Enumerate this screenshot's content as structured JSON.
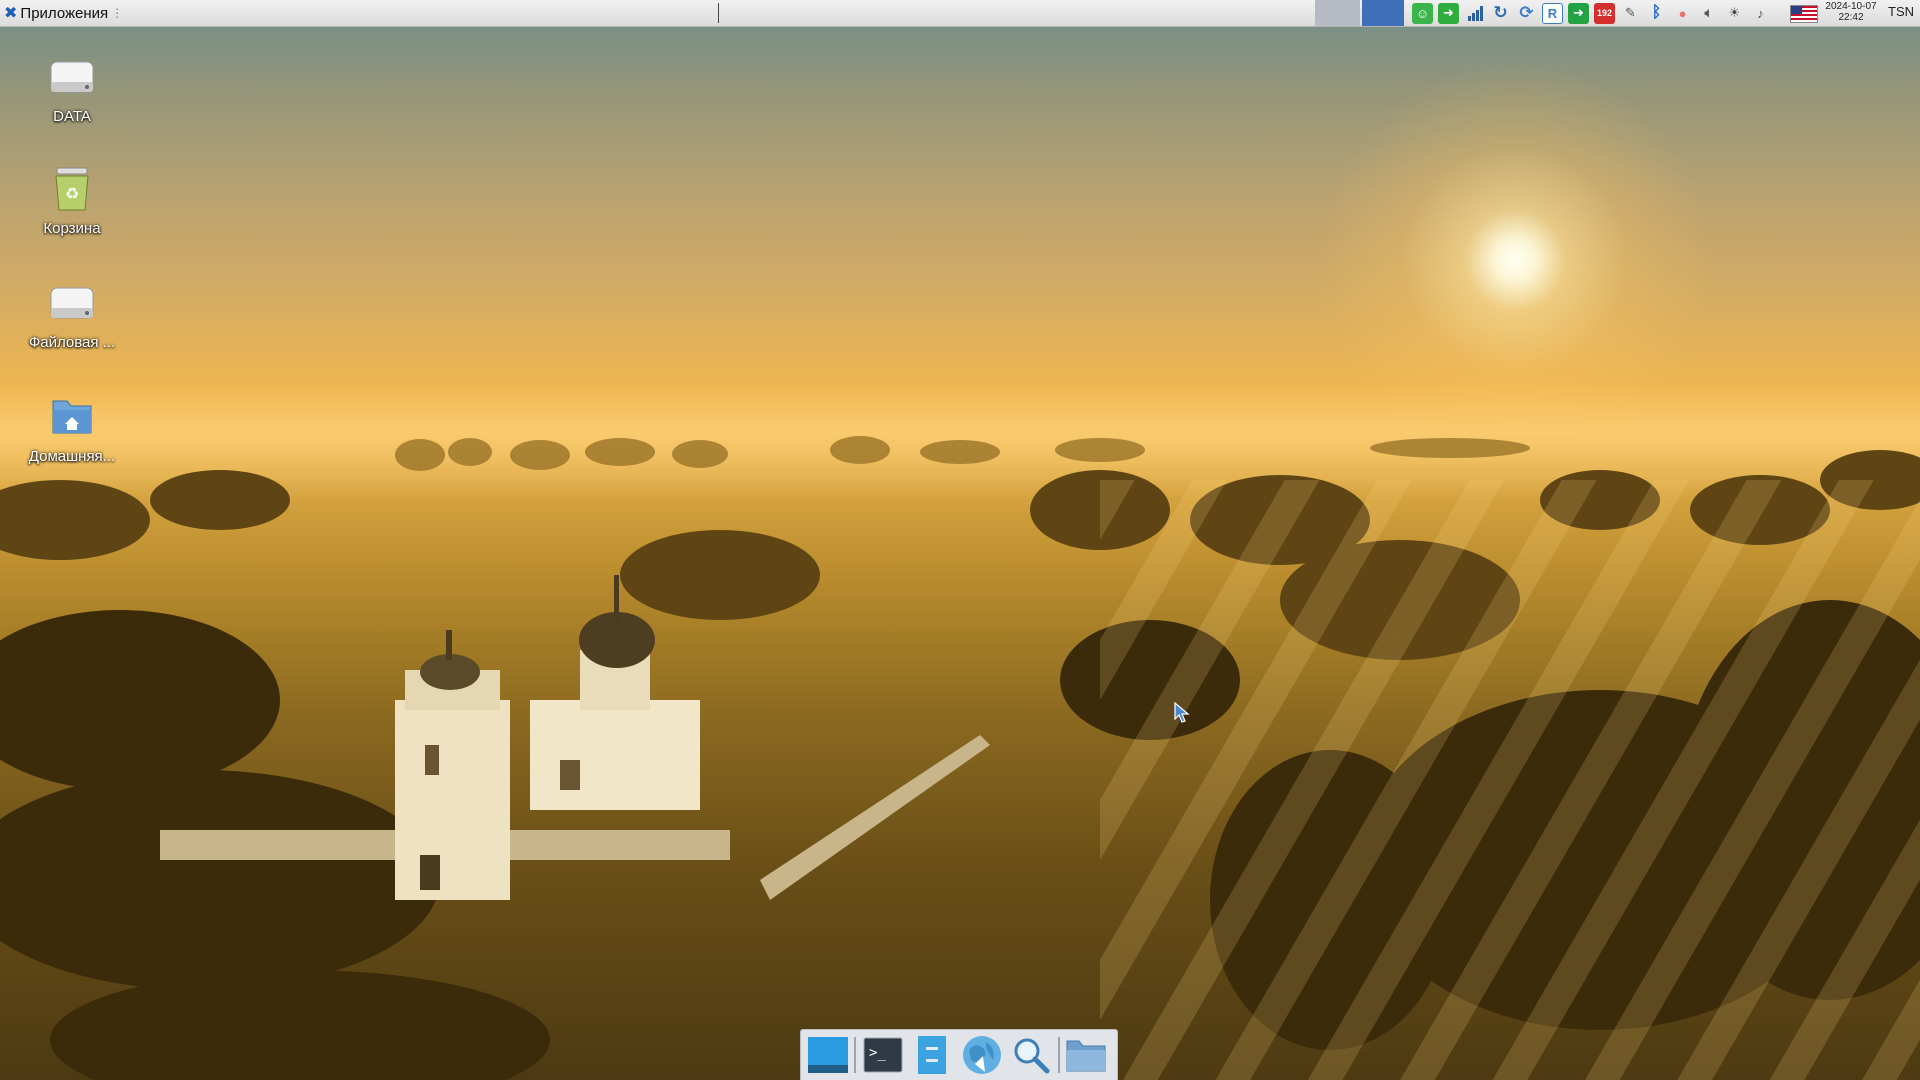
{
  "top_panel": {
    "apps_menu_label": "Приложения",
    "clock_date": "2024-10-07",
    "clock_time": "22:42",
    "keyboard_layout": "TSN",
    "tray_badge": "192",
    "tray_icons": [
      "green-app-icon",
      "green-screen-icon",
      "signal-bars-icon",
      "sync-icon",
      "update-icon",
      "remote-desktop-icon",
      "green-arrow-icon",
      "shield-badge-icon",
      "network-icon",
      "bluetooth-icon",
      "red-balloon-icon",
      "volume-icon",
      "weather-icon",
      "notifications-muted-icon",
      "us-flag-icon"
    ]
  },
  "desktop": {
    "icons": [
      {
        "label": "DATA",
        "icon": "drive-icon"
      },
      {
        "label": "Корзина",
        "icon": "trash-icon"
      },
      {
        "label": "Файловая ...",
        "icon": "drive-icon"
      },
      {
        "label": "Домашняя...",
        "icon": "home-folder-icon"
      }
    ]
  },
  "dock": {
    "items": [
      "show-desktop-icon",
      "terminal-icon",
      "file-manager-icon",
      "web-browser-icon",
      "search-icon",
      "folder-icon"
    ]
  },
  "colors": {
    "panel": "#e6e6e6",
    "workspace_active": "#3f6fb8",
    "accent": "#1e5fb4"
  }
}
